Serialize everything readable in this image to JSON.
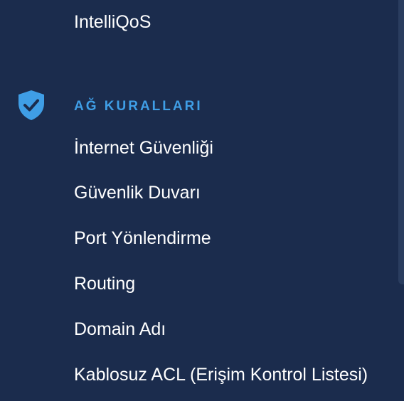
{
  "menu": {
    "top_item": "IntelliQoS",
    "section": {
      "title": "AĞ KURALLARI",
      "icon": "shield-check-icon",
      "accent_color": "#3f9ee6",
      "items": [
        "İnternet Güvenliği",
        "Güvenlik Duvarı",
        "Port Yönlendirme",
        "Routing",
        "Domain Adı",
        "Kablosuz ACL (Erişim Kontrol Listesi)"
      ]
    }
  }
}
